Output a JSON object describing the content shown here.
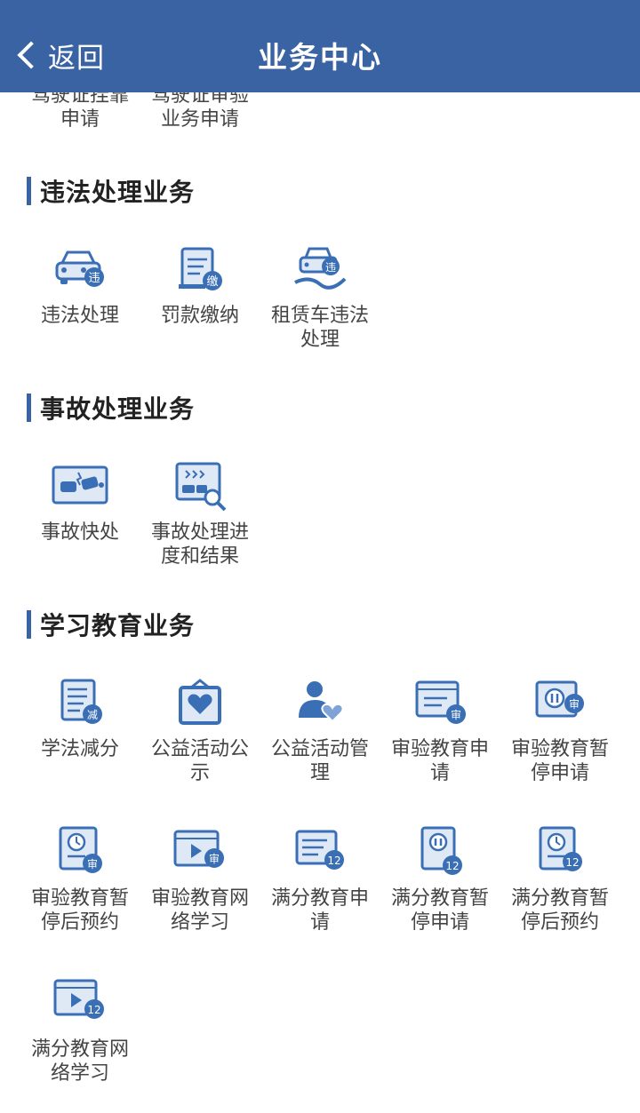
{
  "header": {
    "back_label": "返回",
    "title": "业务中心"
  },
  "colors": {
    "header_bg": "#3a63a3",
    "accent": "#3a63a3",
    "icon_primary": "#3a6fb5"
  },
  "partial_items": [
    {
      "label": "驾驶证挂靠申请",
      "icon": "license-icon"
    },
    {
      "label": "驾驶证审验业务申请",
      "icon": "license-review-icon"
    }
  ],
  "sections": [
    {
      "title": "违法处理业务",
      "items": [
        {
          "label": "违法处理",
          "icon": "car-violation-icon",
          "badge": "违"
        },
        {
          "label": "罚款缴纳",
          "icon": "fine-payment-icon",
          "badge": "缴"
        },
        {
          "label": "租赁车违法处理",
          "icon": "rental-car-violation-icon",
          "badge": "违"
        }
      ]
    },
    {
      "title": "事故处理业务",
      "items": [
        {
          "label": "事故快处",
          "icon": "accident-quick-icon"
        },
        {
          "label": "事故处理进度和结果",
          "icon": "accident-progress-icon"
        }
      ]
    },
    {
      "title": "学习教育业务",
      "items": [
        {
          "label": "学法减分",
          "icon": "study-deduct-icon",
          "badge": "减"
        },
        {
          "label": "公益活动公示",
          "icon": "charity-notice-icon"
        },
        {
          "label": "公益活动管理",
          "icon": "charity-manage-icon"
        },
        {
          "label": "审验教育申请",
          "icon": "review-edu-apply-icon",
          "badge": "审"
        },
        {
          "label": "审验教育暂停申请",
          "icon": "review-edu-pause-icon",
          "badge": "审"
        },
        {
          "label": "审验教育暂停后预约",
          "icon": "review-edu-reserve-icon",
          "badge": "审"
        },
        {
          "label": "审验教育网络学习",
          "icon": "review-edu-online-icon",
          "badge": "审"
        },
        {
          "label": "满分教育申请",
          "icon": "full-score-apply-icon",
          "badge": "12"
        },
        {
          "label": "满分教育暂停申请",
          "icon": "full-score-pause-icon",
          "badge": "12"
        },
        {
          "label": "满分教育暂停后预约",
          "icon": "full-score-reserve-icon",
          "badge": "12"
        },
        {
          "label": "满分教育网络学习",
          "icon": "full-score-online-icon",
          "badge": "12"
        }
      ]
    }
  ]
}
